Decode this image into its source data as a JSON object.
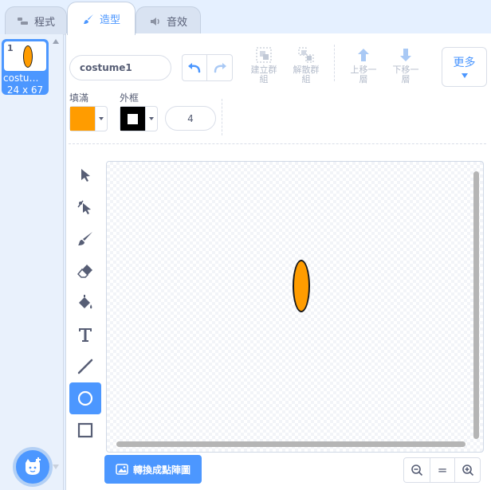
{
  "tabs": [
    {
      "label": "程式",
      "icon": "code-icon",
      "active": false
    },
    {
      "label": "造型",
      "icon": "brush-icon",
      "active": true
    },
    {
      "label": "音效",
      "icon": "speaker-icon",
      "active": false
    }
  ],
  "costumes": [
    {
      "number": "1",
      "name": "costume…",
      "size": "24 x 67"
    }
  ],
  "toolbar": {
    "costume_name": "costume1",
    "group_label": "建立群組",
    "ungroup_label": "解散群組",
    "forward_label": "上移一層",
    "backward_label": "下移一層",
    "more_label": "更多"
  },
  "fill": {
    "label": "填滿",
    "color": "#ff9c00"
  },
  "outline": {
    "label": "外框",
    "color": "#000000",
    "width": "4"
  },
  "tools": [
    "select-tool",
    "reshape-tool",
    "brush-tool",
    "eraser-tool",
    "fill-tool",
    "text-tool",
    "line-tool",
    "circle-tool",
    "rect-tool"
  ],
  "active_tool": "circle-tool",
  "bottom": {
    "convert_label": "轉換成點陣圖",
    "zoom_reset_label": "="
  },
  "colors": {
    "accent": "#4c97ff",
    "sprite_fill": "#ff9c00"
  }
}
